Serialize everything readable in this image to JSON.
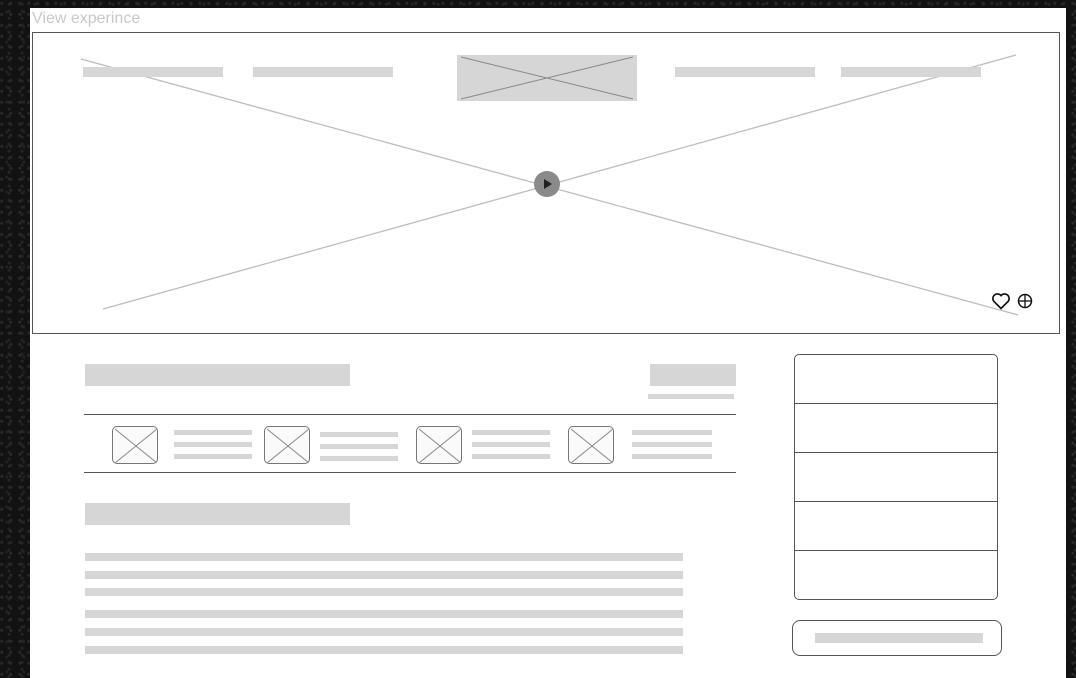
{
  "sheet": {
    "label": "View experince"
  },
  "hero": {
    "nav_items": 4,
    "icons": {
      "favorite": "heart-icon",
      "share": "globe-icon",
      "play": "play-icon"
    }
  },
  "content": {
    "thumbnail_count": 4,
    "side_list_rows": 5
  },
  "colors": {
    "placeholder_fill": "#d6d6d6",
    "outline": "#555555",
    "backdrop": "#121212",
    "sheet": "#ffffff"
  }
}
